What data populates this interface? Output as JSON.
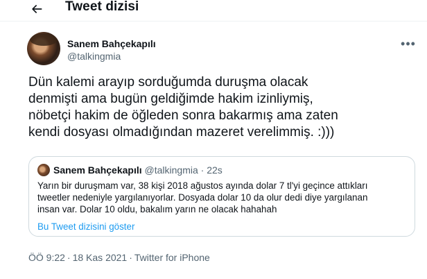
{
  "header": {
    "title": "Tweet dizisi",
    "back_icon": "arrow-left-icon"
  },
  "tweet": {
    "author_name": "Sanem Bahçekapılı",
    "author_handle": "@talkingmia",
    "more_icon": "more-horizontal-icon",
    "text_lines": [
      "Dün kalemi arayıp sorduğumda duruşma olacak",
      "denmişti ama bugün geldiğimde hakim izinliymiş,",
      "nöbetçi hakim de öğleden sonra bakarmış ama zaten",
      "kendi dosyası olmadığından mazeret verelimmiş. :)))"
    ],
    "quote": {
      "author_name": "Sanem Bahçekapılı",
      "author_handle": "@talkingmia",
      "separator": "·",
      "time": "22s",
      "text_lines": [
        "Yarın bir duruşmam var, 38 kişi 2018 ağustos ayında dolar 7 tl'yi geçince attıkları",
        "tweetler nedeniyle yargılanıyorlar. Dosyada dolar 10 da olur dedi diye yargılanan",
        "insan var. Dolar 10 oldu, bakalım yarın ne olacak hahahah"
      ],
      "show_thread": "Bu Tweet dizisini göster"
    },
    "time": "ÖÖ 9:22",
    "separator": "·",
    "date": "18 Kas 2021",
    "source": "Twitter for iPhone"
  },
  "colors": {
    "text": "#0f1419",
    "secondary": "#536471",
    "link": "#1d9bf0",
    "border": "#cfd9de"
  }
}
